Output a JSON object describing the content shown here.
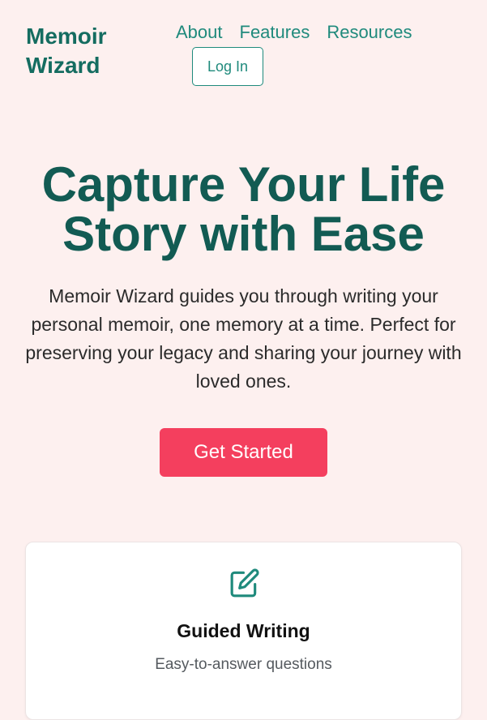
{
  "header": {
    "brand": "Memoir Wizard",
    "nav": [
      {
        "label": "About"
      },
      {
        "label": "Features"
      },
      {
        "label": "Resources"
      }
    ],
    "login_label": "Log In"
  },
  "hero": {
    "title": "Capture Your Life Story with Ease",
    "description": "Memoir Wizard guides you through writing your personal memoir, one memory at a time. Perfect for preserving your legacy and sharing your journey with loved ones.",
    "cta_label": "Get Started"
  },
  "features": [
    {
      "icon": "edit-icon",
      "title": "Guided Writing",
      "description": "Easy-to-answer questions"
    }
  ],
  "colors": {
    "background": "#fdf0ef",
    "brand": "#146c60",
    "accent": "#1f8a7c",
    "cta": "#f43f5e"
  }
}
